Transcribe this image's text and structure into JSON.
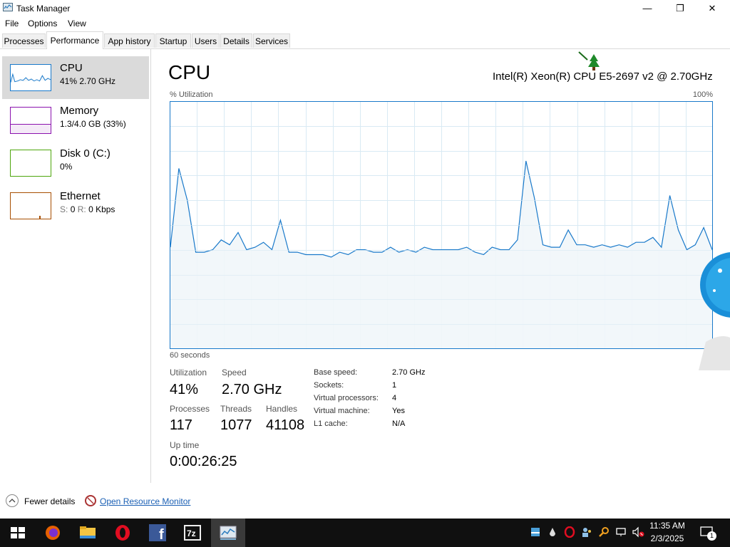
{
  "window": {
    "title": "Task Manager",
    "controls": {
      "minimize": "—",
      "maximize": "❐",
      "close": "✕"
    }
  },
  "menu": [
    "File",
    "Options",
    "View"
  ],
  "tabs": [
    {
      "label": "Processes"
    },
    {
      "label": "Performance",
      "active": true
    },
    {
      "label": "App history"
    },
    {
      "label": "Startup"
    },
    {
      "label": "Users"
    },
    {
      "label": "Details"
    },
    {
      "label": "Services"
    }
  ],
  "sidebar": {
    "items": [
      {
        "name": "CPU",
        "sub": "41% 2.70 GHz",
        "color": "#1979ca",
        "selected": true
      },
      {
        "name": "Memory",
        "sub": "1.3/4.0 GB (33%)",
        "color": "#8b12ae"
      },
      {
        "name": "Disk 0 (C:)",
        "sub": "0%",
        "color": "#4da60c"
      },
      {
        "name": "Ethernet",
        "sub_s_label": "S:",
        "sub_s_val": "0",
        "sub_r_label": "R:",
        "sub_r_val": "0 Kbps",
        "color": "#a74f01"
      }
    ]
  },
  "main": {
    "title": "CPU",
    "model": "Intel(R) Xeon(R) CPU E5-2697 v2 @ 2.70GHz",
    "y_label": "% Utilization",
    "y_max_label": "100%",
    "x_label": "60 seconds"
  },
  "chart_data": {
    "type": "area",
    "ylabel": "% Utilization",
    "xlabel": "60 seconds",
    "ylim": [
      0,
      100
    ],
    "color": "#1979ca",
    "fill": "#f1f6fa",
    "grid": true,
    "values": [
      41,
      73,
      60,
      39,
      39,
      40,
      44,
      42,
      47,
      40,
      41,
      43,
      40,
      52,
      39,
      39,
      38,
      38,
      38,
      37,
      39,
      38,
      40,
      40,
      39,
      39,
      41,
      39,
      40,
      39,
      41,
      40,
      40,
      40,
      40,
      41,
      39,
      38,
      41,
      40,
      40,
      44,
      76,
      61,
      42,
      41,
      41,
      48,
      42,
      42,
      41,
      42,
      41,
      42,
      41,
      43,
      43,
      45,
      41,
      62,
      48,
      40,
      42,
      49,
      40
    ],
    "values_note": ""
  },
  "stats": {
    "utilization": {
      "label": "Utilization",
      "value": "41%"
    },
    "speed": {
      "label": "Speed",
      "value": "2.70 GHz"
    },
    "processes": {
      "label": "Processes",
      "value": "117"
    },
    "threads": {
      "label": "Threads",
      "value": "1077"
    },
    "handles": {
      "label": "Handles",
      "value": "41108"
    },
    "uptime": {
      "label": "Up time",
      "value": "0:00:26:25"
    }
  },
  "details": [
    {
      "key": "Base speed:",
      "value": "2.70 GHz"
    },
    {
      "key": "Sockets:",
      "value": "1"
    },
    {
      "key": "Virtual processors:",
      "value": "4"
    },
    {
      "key": "Virtual machine:",
      "value": "Yes"
    },
    {
      "key": "L1 cache:",
      "value": "N/A"
    }
  ],
  "footer": {
    "fewer_details": "Fewer details",
    "resource_monitor": "Open Resource Monitor"
  },
  "taskbar": {
    "apps": [
      "windows-start-icon",
      "firefox-icon",
      "file-explorer-icon",
      "opera-icon",
      "facebook-icon",
      "7zip-icon",
      "task-manager-icon"
    ],
    "tray_icons": [
      "network-icon",
      "drop-icon",
      "opera-tray-icon",
      "people-icon",
      "search-tray-icon",
      "display-icon",
      "speaker-muted-icon"
    ],
    "time": "11:35 AM",
    "date": "2/3/2025",
    "notification_count": "1"
  }
}
